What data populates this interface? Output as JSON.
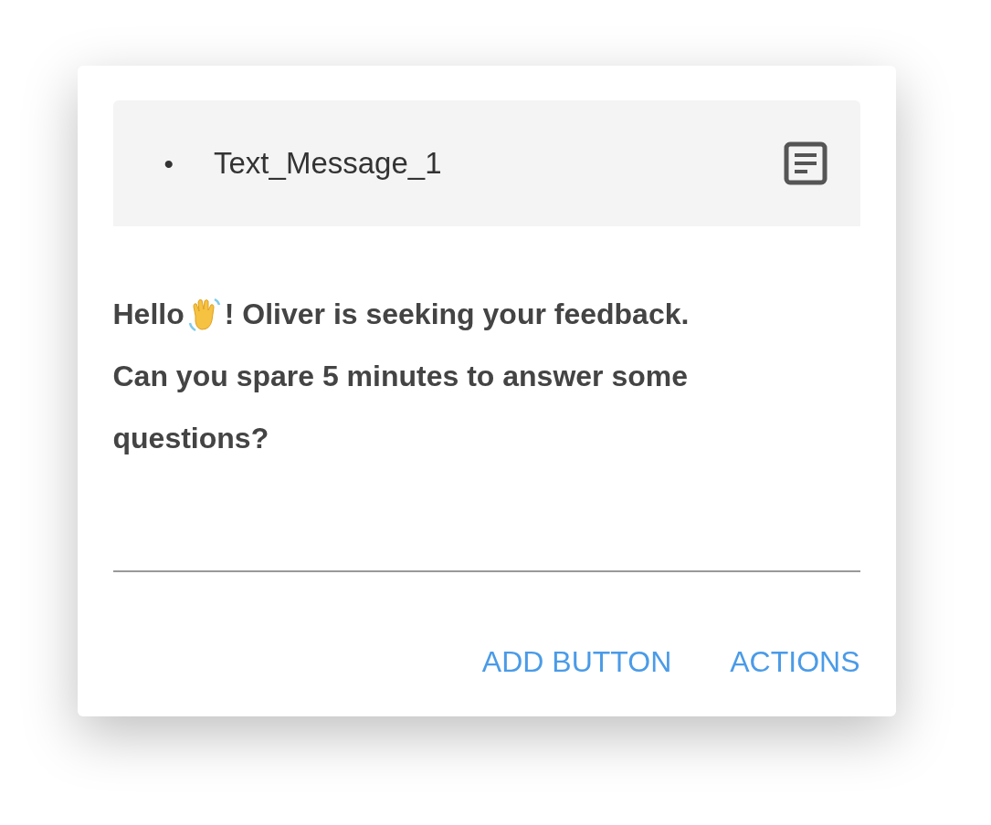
{
  "header": {
    "bullet": "•",
    "title": "Text_Message_1"
  },
  "message": {
    "greeting": "Hello",
    "rest": "! Oliver is seeking your feedback.",
    "continuation": "Can you spare 5 minutes to answer some questions?"
  },
  "buttons": [
    "ADD BUTTON",
    "ACTIONS"
  ]
}
